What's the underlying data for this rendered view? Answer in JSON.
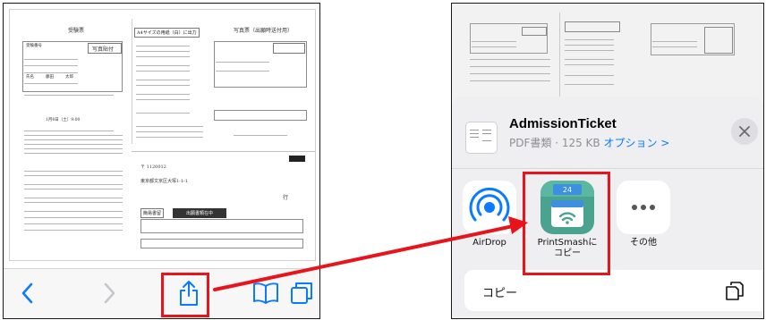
{
  "left_phone": {
    "document": {
      "title_left": "受験票",
      "title_right": "写真票（出願時送付用）",
      "photo_label": "写真貼付",
      "center_box": "A4サイズの用紙（白）に出力",
      "exam_number_label": "受験番号",
      "name_label": "氏名",
      "name_family": "藤田",
      "name_given": "太郎",
      "date_line": "1月8日（土）9:00",
      "mail_box": "簡易書留",
      "mail_box_red": "出願書類在中",
      "postal": "〒 1120012",
      "address": "東京都文京区大塚1-1-1",
      "to": "行"
    },
    "toolbar": {
      "back_icon": "chevron-left",
      "forward_icon": "chevron-right",
      "share_icon": "share",
      "bookmarks_icon": "book",
      "tabs_icon": "tabs"
    }
  },
  "right_phone": {
    "file": {
      "title": "AdmissionTicket",
      "subtitle": "PDF書類 · 125 KB ",
      "options": "オプション >"
    },
    "apps": [
      {
        "label": "AirDrop",
        "icon": "airdrop"
      },
      {
        "label": "PrintSmashに\nコピー",
        "icon": "printsmash",
        "badge": "24"
      },
      {
        "label": "その他",
        "icon": "more"
      }
    ],
    "actions": {
      "copy": "コピー"
    }
  },
  "colors": {
    "highlight": "#e8141b",
    "ios_blue": "#0a7aff",
    "printsmash_bg": "#4aa38e"
  }
}
